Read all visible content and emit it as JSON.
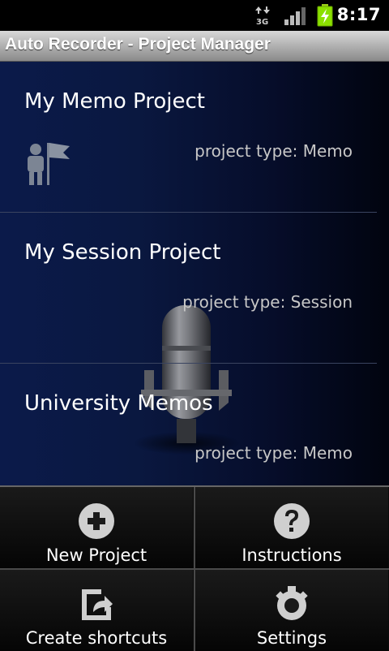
{
  "status_bar": {
    "time": "8:17",
    "network_label": "3G",
    "icons": [
      "data-arrows-icon",
      "signal-icon",
      "battery-charging-icon"
    ]
  },
  "header": {
    "title": "Auto Recorder - Project Manager"
  },
  "projects": [
    {
      "name": "My Memo Project",
      "type_text": "project type: Memo",
      "icon": "person-flag-icon"
    },
    {
      "name": "My Session Project",
      "type_text": "project type: Session"
    },
    {
      "name": "University Memos",
      "type_text": "project type: Memo"
    }
  ],
  "menu": {
    "items": [
      {
        "label": "New Project",
        "icon": "plus-circle-icon"
      },
      {
        "label": "Instructions",
        "icon": "help-circle-icon"
      },
      {
        "label": "Create shortcuts",
        "icon": "shortcut-icon"
      },
      {
        "label": "Settings",
        "icon": "gear-icon"
      }
    ]
  },
  "colors": {
    "list_background": "#0b1a4a",
    "title_bar": "#a8a8a8",
    "battery": "#8be000"
  }
}
